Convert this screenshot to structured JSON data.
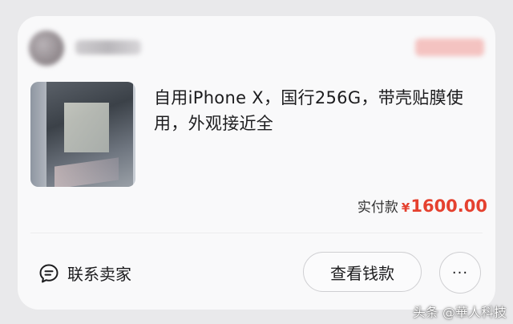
{
  "order_card": {
    "product": {
      "title": "自用iPhone X，国行256G，带壳贴膜使用，外观接近全"
    },
    "price": {
      "label": "实付款",
      "currency_symbol": "¥",
      "amount": "1600.00"
    },
    "actions": {
      "contact_seller": "联系卖家",
      "view_payment": "查看钱款",
      "more": "···"
    }
  },
  "watermark": "头条 @華人科技",
  "colors": {
    "price": "#e5412f",
    "card_background": "#f9f9fa",
    "page_background": "#e9e9eb"
  },
  "icons": {
    "contact": "chat-bubble-icon"
  }
}
